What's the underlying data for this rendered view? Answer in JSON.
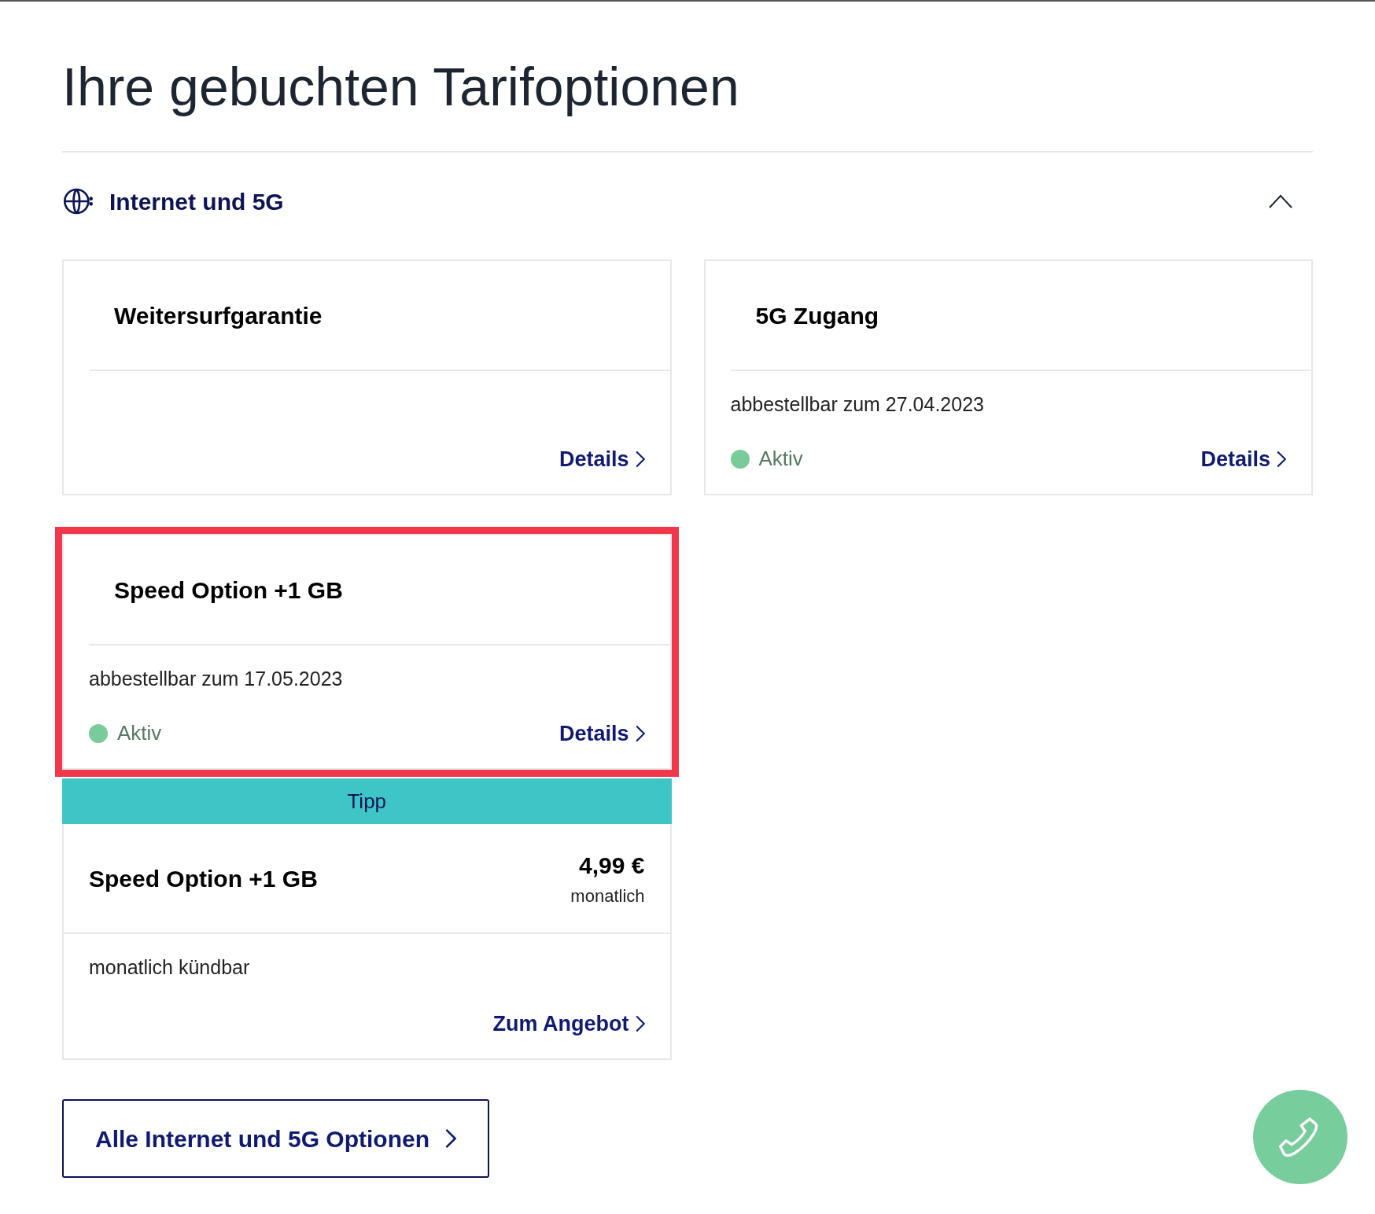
{
  "page": {
    "title": "Ihre gebuchten Tarifoptionen"
  },
  "section": {
    "title": "Internet und 5G",
    "expanded": true,
    "options": [
      {
        "title": "Weitersurfgarantie",
        "link": "Details",
        "highlighted": false
      },
      {
        "title": "5G Zugang",
        "note": "abbestellbar zum 27.04.2023",
        "status": {
          "label": "Aktiv",
          "color": "#7acb9a"
        },
        "link": "Details",
        "highlighted": false
      },
      {
        "title": "Speed Option +1 GB",
        "note": "abbestellbar zum 17.05.2023",
        "status": {
          "label": "Aktiv",
          "color": "#7acb9a"
        },
        "link": "Details",
        "highlighted": true
      }
    ],
    "tip": {
      "label": "Tipp",
      "title": "Speed Option +1 GB",
      "price": "4,99 €",
      "period": "monatlich",
      "note": "monatlich kündbar",
      "link": "Zum Angebot"
    },
    "all_button": "Alle Internet und 5G Optionen"
  }
}
